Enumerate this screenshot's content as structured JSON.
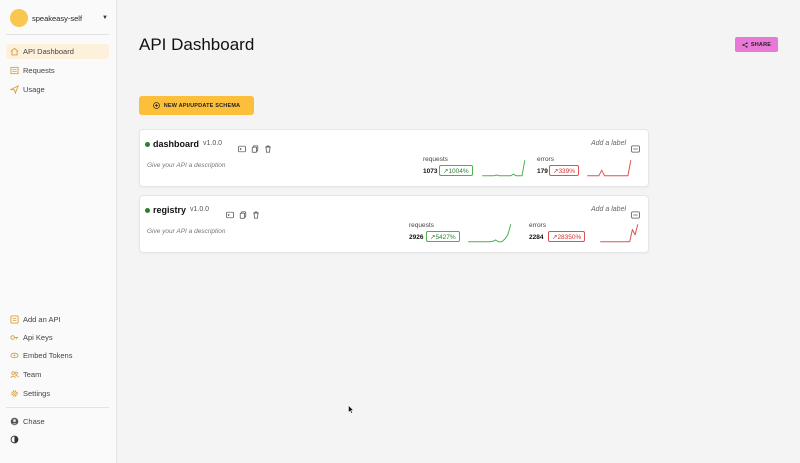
{
  "sidebar": {
    "workspace": "speakeasy-self",
    "nav": [
      {
        "label": "API Dashboard",
        "icon": "home-icon",
        "active": true
      },
      {
        "label": "Requests",
        "icon": "list-icon",
        "active": false
      },
      {
        "label": "Usage",
        "icon": "send-icon",
        "active": false
      }
    ],
    "bottom_nav": [
      {
        "label": "Add an API",
        "icon": "add-api-icon"
      },
      {
        "label": "Api Keys",
        "icon": "key-icon"
      },
      {
        "label": "Embed Tokens",
        "icon": "eye-icon"
      },
      {
        "label": "Team",
        "icon": "team-icon"
      },
      {
        "label": "Settings",
        "icon": "gear-icon"
      }
    ],
    "user": {
      "name": "Chase",
      "icon": "user-avatar-icon"
    },
    "theme_icon": "theme-toggle-icon"
  },
  "header": {
    "title": "API Dashboard",
    "share_label": "SHARE"
  },
  "new_api_label": "NEW API/UPDATE SCHEMA",
  "apis": [
    {
      "name": "dashboard",
      "version": "v1.0.0",
      "description": "Give your API a description",
      "add_label": "Add a label",
      "requests_label": "requests",
      "requests": "1073",
      "requests_change": "↗1004%",
      "errors_label": "errors",
      "errors": "179",
      "errors_change": "↗339%",
      "requests_series": [
        0,
        0,
        0,
        0,
        0,
        0.05,
        0,
        0,
        0,
        0,
        0,
        0.1,
        0,
        0,
        0,
        1
      ],
      "errors_series": [
        0,
        0,
        0,
        0,
        0,
        0.35,
        0,
        0,
        0,
        0,
        0,
        0,
        0,
        0,
        0,
        1
      ]
    },
    {
      "name": "registry",
      "version": "v1.0.0",
      "description": "Give your API a description",
      "add_label": "Add a label",
      "requests_label": "requests",
      "requests": "2926",
      "requests_change": "↗5427%",
      "errors_label": "errors",
      "errors": "2284",
      "errors_change": "↗28350%",
      "requests_series": [
        0,
        0,
        0,
        0,
        0,
        0,
        0,
        0,
        0.02,
        0.1,
        0,
        0,
        0.15,
        0.4,
        1
      ],
      "errors_series": [
        0,
        0,
        0,
        0,
        0,
        0,
        0,
        0,
        0,
        0,
        0,
        0,
        0.7,
        0.4,
        1
      ]
    }
  ],
  "colors": {
    "accent": "#fbbf3b",
    "share": "#e879d6",
    "success": "#4caf50",
    "danger": "#e05050",
    "active_nav": "#fdf1dc"
  }
}
